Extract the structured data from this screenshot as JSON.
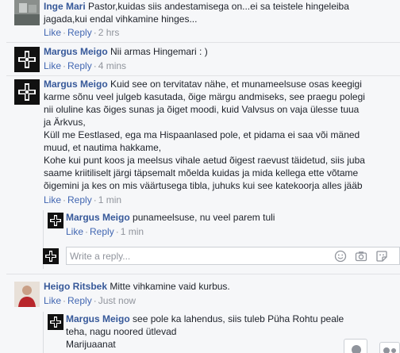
{
  "comments": [
    {
      "author": "Inge Mari",
      "text_line1": "Pastor,kuidas siis andestamisega on...ei sa teistele hingeleiba",
      "text_line2": "jagada,kui endal vihkamine hinges...",
      "like": "Like",
      "reply": "Reply",
      "time": "2 hrs"
    },
    {
      "author": "Margus Meigo",
      "text": "Nii armas Hingemari : )",
      "like": "Like",
      "reply": "Reply",
      "time": "4 mins"
    },
    {
      "author": "Margus Meigo",
      "lines": [
        "Kuid see on tervitatav nähe, et munameelsuse osas keegigi",
        "karme sõnu veel julgeb kasutada, õige märgu andmiseks, see praegu polegi",
        "nii oluline kas õiges sunas ja õiget moodi, kuid Valvsus on vaja ülesse tuua",
        "ja Ärkvus,",
        "Küll me Eestlased, ega ma Hispaanlased pole, et pidama ei saa või mäned",
        "muud, et nautima hakkame,",
        "Kohe kui punt koos ja meelsus vihale aetud õigest raevust täidetud, siis juba",
        "saame kriitiliselt järgi täpsemalt mõelda kuidas ja mida kellega ette võtame",
        "õigemini ja kes on mis väärtusega tibla, juhuks kui see katekoorja alles jääb"
      ],
      "like": "Like",
      "reply": "Reply",
      "time": "1 min"
    },
    {
      "author": "Margus Meigo",
      "text": "punameelsuse, nu veel parem tuli",
      "like": "Like",
      "reply": "Reply",
      "time": "1 min"
    },
    {
      "author": "Heigo Ritsbek",
      "text": "Mitte vihkamine vaid kurbus.",
      "like": "Like",
      "reply": "Reply",
      "time": "Just now"
    },
    {
      "author": "Margus Meigo",
      "text_line1": "see pole ka lahendus, siis tuleb Püha Rohtu peale",
      "text_line2": "teha, nagu noored ütlevad",
      "text_line3": "Marijuaanat"
    }
  ],
  "reply_box": {
    "placeholder": "Write a reply..."
  },
  "icons": {
    "avatar_cross": "black-cross-emblem",
    "emoji": "emoji-icon",
    "camera": "camera-icon",
    "sticker": "sticker-icon"
  }
}
